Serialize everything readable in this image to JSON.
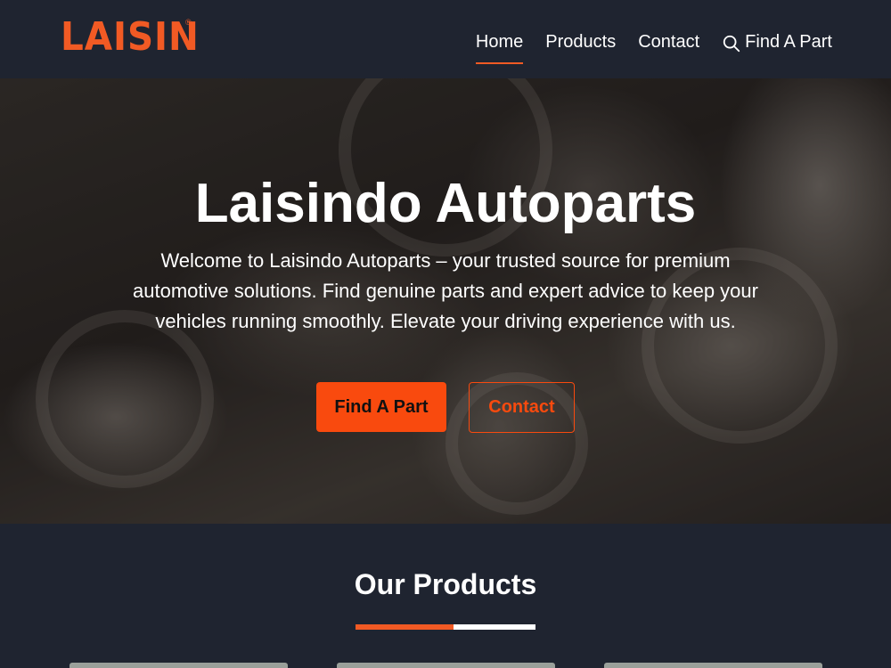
{
  "header": {
    "logo": "LAISIN",
    "logo_reg": "®",
    "nav": [
      {
        "label": "Home",
        "active": true
      },
      {
        "label": "Products",
        "active": false
      },
      {
        "label": "Contact",
        "active": false
      }
    ],
    "find_part": {
      "label": "Find A Part",
      "icon": "search-icon"
    }
  },
  "hero": {
    "title": "Laisindo Autoparts",
    "description": "Welcome to Laisindo Autoparts – your trusted source for premium automotive solutions. Find genuine parts and expert advice to keep your vehicles running smoothly. Elevate your driving experience with us.",
    "primary_button": "Find A Part",
    "secondary_button": "Contact"
  },
  "products": {
    "title": "Our Products",
    "cards": [
      {},
      {},
      {}
    ]
  },
  "colors": {
    "accent": "#f15a24",
    "button": "#f94a0e",
    "background": "#1f2430"
  }
}
